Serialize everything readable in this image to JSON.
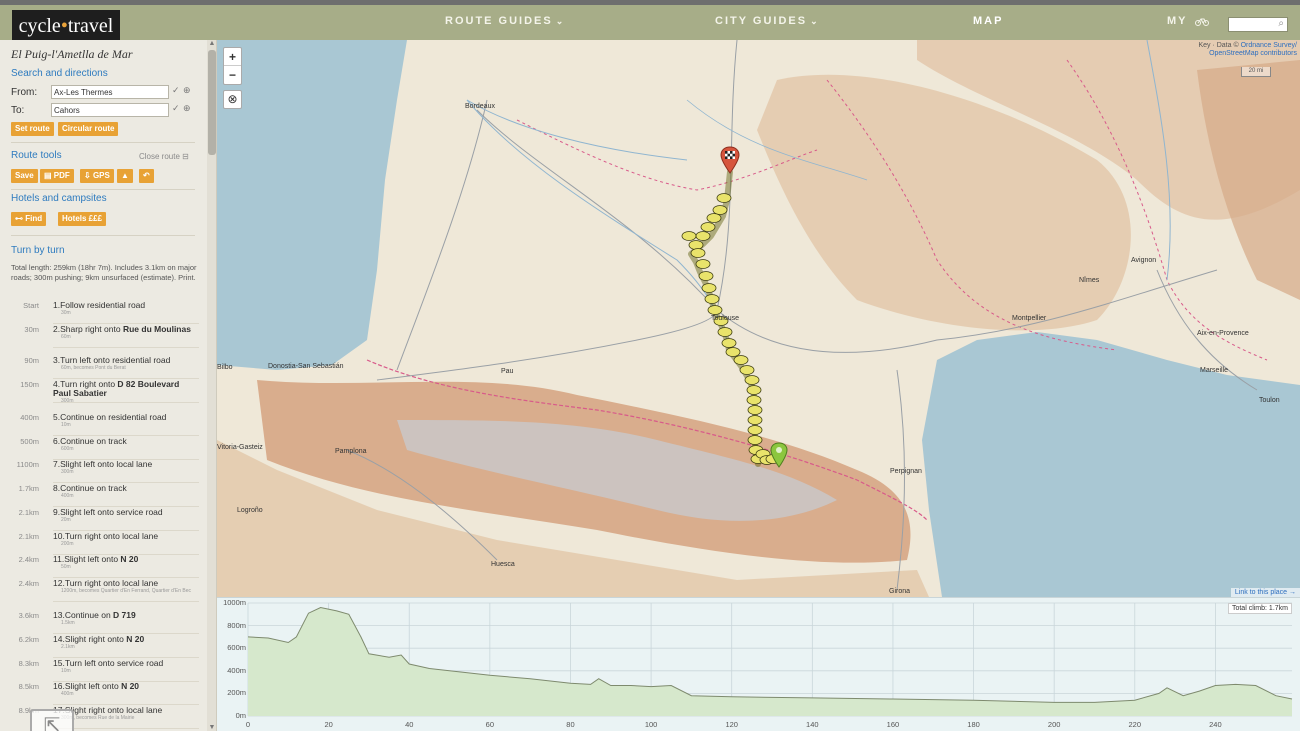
{
  "header": {
    "logo_left": "cycle",
    "logo_dot": "•",
    "logo_right": "travel",
    "nav": [
      {
        "label": "ROUTE GUIDES",
        "chevron": "⌄"
      },
      {
        "label": "CITY GUIDES",
        "chevron": "⌄"
      },
      {
        "label": "MAP",
        "chevron": ""
      }
    ],
    "my_label": "MY",
    "bike_icon": "bicycle-icon",
    "search_icon": "magnifier-icon"
  },
  "sidebar": {
    "place_title": "El Puig-l'Ametlla de Mar",
    "search_heading": "Search and directions",
    "from_label": "From:",
    "from_value": "Ax-Les Thermes",
    "to_label": "To:",
    "to_value": "Cahors",
    "set_route": "Set route",
    "circular_route": "Circular route",
    "route_tools_heading": "Route tools",
    "close_route": "Close route",
    "tools": [
      {
        "label": "Save",
        "icon": ""
      },
      {
        "label": "PDF",
        "icon": "printer-icon"
      },
      {
        "label": "GPS",
        "icon": "gps-icon"
      },
      {
        "label": "",
        "icon": "hill-icon"
      },
      {
        "label": "",
        "icon": "undo-icon"
      }
    ],
    "hotels_heading": "Hotels and campsites",
    "find_label": "Find",
    "hotels_label": "Hotels £££",
    "turn_heading": "Turn by turn",
    "summary": "Total length: 259km (18hr 7m). Includes 3.1km on major roads; 300m pushing; 9km unsurfaced (estimate). Print.",
    "turns": [
      {
        "dist": "Start",
        "num": "1.",
        "text": "Follow residential road",
        "bold": "",
        "sub": "30m"
      },
      {
        "dist": "30m",
        "num": "2.",
        "text": "Sharp right onto ",
        "bold": "Rue du Moulinas",
        "sub": "60m"
      },
      {
        "dist": "90m",
        "num": "3.",
        "text": "Turn left onto residential road",
        "bold": "",
        "sub": "60m, becomes Pont du Berat"
      },
      {
        "dist": "150m",
        "num": "4.",
        "text": "Turn right onto ",
        "bold": "D 82 Boulevard Paul Sabatier",
        "sub": "300m"
      },
      {
        "dist": "400m",
        "num": "5.",
        "text": "Continue on residential road",
        "bold": "",
        "sub": "10m"
      },
      {
        "dist": "500m",
        "num": "6.",
        "text": "Continue on track",
        "bold": "",
        "sub": "600m"
      },
      {
        "dist": "1100m",
        "num": "7.",
        "text": "Slight left onto local lane",
        "bold": "",
        "sub": "300m"
      },
      {
        "dist": "1.7km",
        "num": "8.",
        "text": "Continue on track",
        "bold": "",
        "sub": "400m"
      },
      {
        "dist": "2.1km",
        "num": "9.",
        "text": "Slight left onto service road",
        "bold": "",
        "sub": "20m"
      },
      {
        "dist": "2.1km",
        "num": "10.",
        "text": "Turn right onto local lane",
        "bold": "",
        "sub": "200m"
      },
      {
        "dist": "2.4km",
        "num": "11.",
        "text": "Slight left onto ",
        "bold": "N 20",
        "sub": "50m"
      },
      {
        "dist": "2.4km",
        "num": "12.",
        "text": "Turn right onto local lane",
        "bold": "",
        "sub": "1200m, becomes Quartier d'En Ferrand, Quartier d'En Bec"
      },
      {
        "dist": "3.6km",
        "num": "13.",
        "text": "Continue on ",
        "bold": "D 719",
        "sub": "1.5km"
      },
      {
        "dist": "6.2km",
        "num": "14.",
        "text": "Slight right onto ",
        "bold": "N 20",
        "sub": "2.1km"
      },
      {
        "dist": "8.3km",
        "num": "15.",
        "text": "Turn left onto service road",
        "bold": "",
        "sub": "10m"
      },
      {
        "dist": "8.5km",
        "num": "16.",
        "text": "Slight left onto ",
        "bold": "N 20",
        "sub": "400m"
      },
      {
        "dist": "8.9km",
        "num": "17.",
        "text": "Slight right onto local lane",
        "bold": "",
        "sub": "300m, becomes Rue de la Mairie"
      }
    ]
  },
  "map": {
    "zoom_in": "+",
    "zoom_out": "−",
    "locate_icon": "⊗",
    "attribution_1": "Key · Data ©",
    "attribution_link1": "Ordnance Survey/",
    "attribution_link2": "OpenStreetMap contributors",
    "scale": "20 mi",
    "link_place": "Link to this place →",
    "cities": [
      "Bordeaux",
      "Toulouse",
      "Pau",
      "Donostia-San Sebastián",
      "Pamplona",
      "Logroño",
      "Huesca",
      "Perpignan",
      "Girona",
      "Montpellier",
      "Nîmes",
      "Avignon",
      "Aix-en-Provence",
      "Marseille",
      "Toulon",
      "Vitoria-Gasteiz",
      "Bilbo"
    ],
    "colors": {
      "route": "#e9e36b",
      "sea": "#a9c7d3",
      "land": "#efe8d8",
      "mountain": "#d9ad8d",
      "border": "#d85a8a"
    }
  },
  "profile": {
    "total_climb": "Total climb: 1.7km",
    "y_labels": [
      "1000m",
      "800m",
      "600m",
      "400m",
      "200m",
      "0m"
    ],
    "x_labels": [
      "0",
      "20",
      "40",
      "60",
      "80",
      "100",
      "120",
      "140",
      "160",
      "180",
      "200",
      "220",
      "240"
    ]
  },
  "chart_data": {
    "type": "area",
    "title": "",
    "xlabel": "",
    "ylabel": "",
    "xlim": [
      0,
      259
    ],
    "ylim": [
      0,
      1000
    ],
    "grid": true,
    "x": [
      0,
      5,
      10,
      12,
      15,
      18,
      22,
      25,
      28,
      30,
      35,
      38,
      40,
      45,
      50,
      60,
      70,
      80,
      85,
      87,
      90,
      95,
      100,
      105,
      110,
      120,
      140,
      160,
      180,
      200,
      210,
      220,
      226,
      228,
      232,
      236,
      240,
      245,
      250,
      255,
      259
    ],
    "series": [
      {
        "values": [
          700,
          690,
          650,
          700,
          910,
          960,
          930,
          900,
          700,
          550,
          520,
          540,
          460,
          420,
          400,
          360,
          330,
          290,
          280,
          330,
          270,
          270,
          260,
          270,
          180,
          170,
          160,
          150,
          140,
          120,
          120,
          140,
          200,
          250,
          180,
          220,
          270,
          280,
          270,
          180,
          150
        ]
      }
    ]
  }
}
